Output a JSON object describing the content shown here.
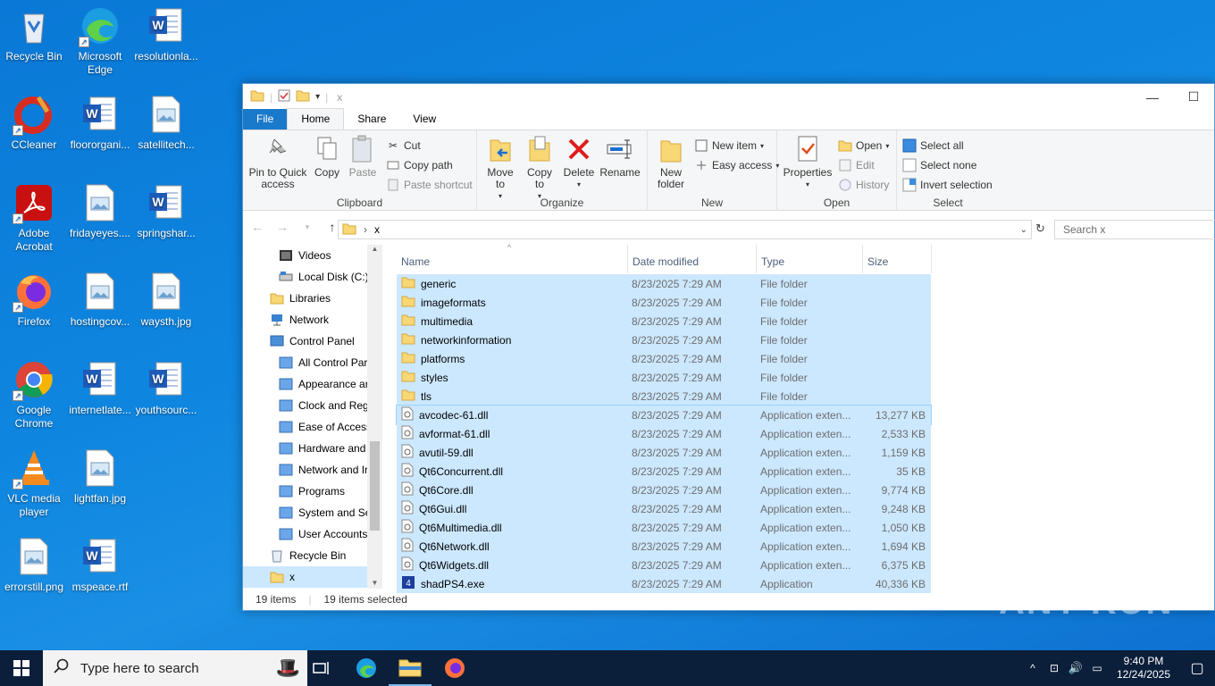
{
  "desktop": {
    "icons": [
      {
        "label": "Recycle Bin",
        "icon": "recycle-bin-icon"
      },
      {
        "label": "Microsoft Edge",
        "icon": "edge-icon"
      },
      {
        "label": "resolutionla...",
        "icon": "word-doc-icon"
      },
      {
        "label": "CCleaner",
        "icon": "ccleaner-icon"
      },
      {
        "label": "floororgani...",
        "icon": "word-doc-icon"
      },
      {
        "label": "satellitech...",
        "icon": "image-file-icon"
      },
      {
        "label": "Adobe Acrobat",
        "icon": "acrobat-icon"
      },
      {
        "label": "fridayeyes....",
        "icon": "image-file-icon"
      },
      {
        "label": "springshar...",
        "icon": "word-doc-icon"
      },
      {
        "label": "Firefox",
        "icon": "firefox-icon"
      },
      {
        "label": "hostingcov...",
        "icon": "image-file-icon"
      },
      {
        "label": "waysth.jpg",
        "icon": "image-file-icon"
      },
      {
        "label": "Google Chrome",
        "icon": "chrome-icon"
      },
      {
        "label": "internetlate...",
        "icon": "word-doc-icon"
      },
      {
        "label": "youthsourc...",
        "icon": "word-doc-icon"
      },
      {
        "label": "VLC media player",
        "icon": "vlc-icon"
      },
      {
        "label": "lightfan.jpg",
        "icon": "image-file-icon"
      },
      {
        "label": "errorstill.png",
        "icon": "image-file-icon"
      },
      {
        "label": "mspeace.rtf",
        "icon": "word-doc-icon"
      }
    ]
  },
  "window": {
    "title": "x",
    "minimize": "—",
    "maximize": "☐"
  },
  "ribbon": {
    "tabs": [
      "File",
      "Home",
      "Share",
      "View"
    ],
    "clipboard": {
      "label": "Clipboard",
      "pin": "Pin to Quick access",
      "copy": "Copy",
      "paste": "Paste",
      "cut": "Cut",
      "copy_path": "Copy path",
      "paste_shortcut": "Paste shortcut"
    },
    "organize": {
      "label": "Organize",
      "move_to": "Move to",
      "copy_to": "Copy to",
      "delete": "Delete",
      "rename": "Rename"
    },
    "new": {
      "label": "New",
      "new_folder": "New folder",
      "new_item": "New item",
      "easy_access": "Easy access"
    },
    "open": {
      "label": "Open",
      "properties": "Properties",
      "open": "Open",
      "edit": "Edit",
      "history": "History"
    },
    "select": {
      "label": "Select",
      "select_all": "Select all",
      "select_none": "Select none",
      "invert": "Invert selection"
    }
  },
  "address": {
    "path": "x",
    "search_placeholder": "Search x"
  },
  "nav_pane": [
    {
      "label": "Videos",
      "indent": 2
    },
    {
      "label": "Local Disk (C:)",
      "indent": 2
    },
    {
      "label": "Libraries",
      "indent": 1
    },
    {
      "label": "Network",
      "indent": 1
    },
    {
      "label": "Control Panel",
      "indent": 1
    },
    {
      "label": "All Control Par",
      "indent": 2
    },
    {
      "label": "Appearance an",
      "indent": 2
    },
    {
      "label": "Clock and Regi",
      "indent": 2
    },
    {
      "label": "Ease of Access",
      "indent": 2
    },
    {
      "label": "Hardware and",
      "indent": 2
    },
    {
      "label": "Network and Ir",
      "indent": 2
    },
    {
      "label": "Programs",
      "indent": 2
    },
    {
      "label": "System and Se",
      "indent": 2
    },
    {
      "label": "User Accounts",
      "indent": 2
    },
    {
      "label": "Recycle Bin",
      "indent": 1
    },
    {
      "label": "x",
      "indent": 1
    }
  ],
  "columns": {
    "name": "Name",
    "date": "Date modified",
    "type": "Type",
    "size": "Size"
  },
  "files": [
    {
      "name": "generic",
      "date": "8/23/2025 7:29 AM",
      "type": "File folder",
      "size": "",
      "kind": "folder"
    },
    {
      "name": "imageformats",
      "date": "8/23/2025 7:29 AM",
      "type": "File folder",
      "size": "",
      "kind": "folder"
    },
    {
      "name": "multimedia",
      "date": "8/23/2025 7:29 AM",
      "type": "File folder",
      "size": "",
      "kind": "folder"
    },
    {
      "name": "networkinformation",
      "date": "8/23/2025 7:29 AM",
      "type": "File folder",
      "size": "",
      "kind": "folder"
    },
    {
      "name": "platforms",
      "date": "8/23/2025 7:29 AM",
      "type": "File folder",
      "size": "",
      "kind": "folder"
    },
    {
      "name": "styles",
      "date": "8/23/2025 7:29 AM",
      "type": "File folder",
      "size": "",
      "kind": "folder"
    },
    {
      "name": "tls",
      "date": "8/23/2025 7:29 AM",
      "type": "File folder",
      "size": "",
      "kind": "folder"
    },
    {
      "name": "avcodec-61.dll",
      "date": "8/23/2025 7:29 AM",
      "type": "Application exten...",
      "size": "13,277 KB",
      "kind": "dll"
    },
    {
      "name": "avformat-61.dll",
      "date": "8/23/2025 7:29 AM",
      "type": "Application exten...",
      "size": "2,533 KB",
      "kind": "dll"
    },
    {
      "name": "avutil-59.dll",
      "date": "8/23/2025 7:29 AM",
      "type": "Application exten...",
      "size": "1,159 KB",
      "kind": "dll"
    },
    {
      "name": "Qt6Concurrent.dll",
      "date": "8/23/2025 7:29 AM",
      "type": "Application exten...",
      "size": "35 KB",
      "kind": "dll"
    },
    {
      "name": "Qt6Core.dll",
      "date": "8/23/2025 7:29 AM",
      "type": "Application exten...",
      "size": "9,774 KB",
      "kind": "dll"
    },
    {
      "name": "Qt6Gui.dll",
      "date": "8/23/2025 7:29 AM",
      "type": "Application exten...",
      "size": "9,248 KB",
      "kind": "dll"
    },
    {
      "name": "Qt6Multimedia.dll",
      "date": "8/23/2025 7:29 AM",
      "type": "Application exten...",
      "size": "1,050 KB",
      "kind": "dll"
    },
    {
      "name": "Qt6Network.dll",
      "date": "8/23/2025 7:29 AM",
      "type": "Application exten...",
      "size": "1,694 KB",
      "kind": "dll"
    },
    {
      "name": "Qt6Widgets.dll",
      "date": "8/23/2025 7:29 AM",
      "type": "Application exten...",
      "size": "6,375 KB",
      "kind": "dll"
    },
    {
      "name": "shadPS4.exe",
      "date": "8/23/2025 7:29 AM",
      "type": "Application",
      "size": "40,336 KB",
      "kind": "exe"
    }
  ],
  "status": {
    "items": "19 items",
    "selected": "19 items selected"
  },
  "taskbar": {
    "search_placeholder": "Type here to search",
    "time": "9:40 PM",
    "date": "12/24/2025"
  },
  "watermark": "ANY RUN",
  "colors": {
    "selection": "#cce8ff",
    "accent": "#1979ca",
    "taskbar": "#0b1e3a"
  }
}
